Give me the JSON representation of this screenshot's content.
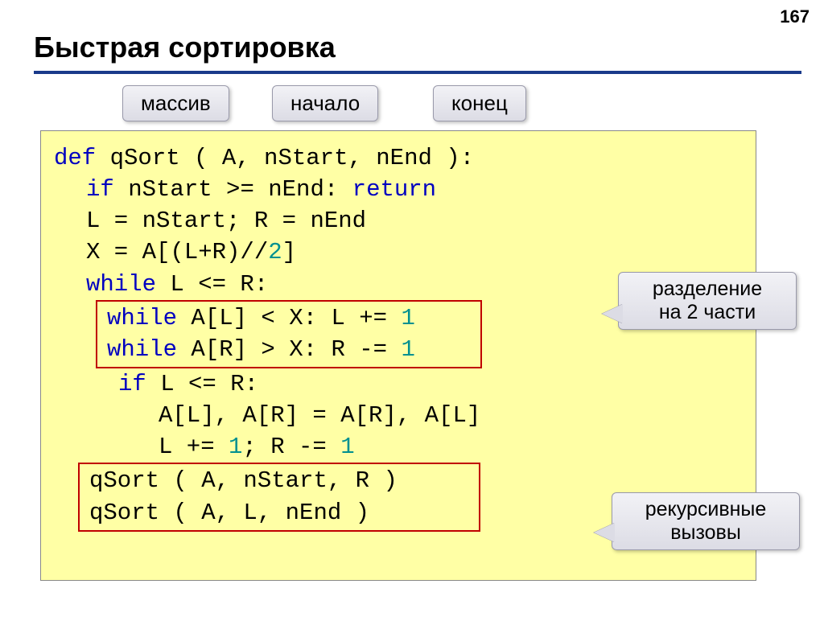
{
  "page_number": "167",
  "title": "Быстрая сортировка",
  "labels": {
    "array": "массив",
    "start": "начало",
    "end": "конец"
  },
  "callouts": {
    "split_l1": "разделение",
    "split_l2": "на 2 части",
    "rec_l1": "рекурсивные",
    "rec_l2": "вызовы"
  },
  "code": {
    "l1a": "def",
    "l1b": " qSort ( A, nStart, nEnd ):",
    "l2a": "if",
    "l2b": " nStart >= nEnd: ",
    "l2c": "return",
    "l3": "L = nStart; R = nEnd",
    "l4a": "X = A[(L+R)//",
    "l4b": "2",
    "l4c": "]",
    "l5a": "while",
    "l5b": " L <= R:",
    "l6a": "while",
    "l6b": " A[L] < X: L += ",
    "l6c": "1",
    "l7a": "while",
    "l7b": " A[R] > X: R -= ",
    "l7c": "1",
    "l8a": "if",
    "l8b": " L <= R:",
    "l9": "A[L], A[R] = A[R], A[L]",
    "l10a": "L += ",
    "l10b": "1",
    "l10c": "; R -= ",
    "l10d": "1",
    "l11": "qSort ( A, nStart, R )",
    "l12": "qSort ( A, L, nEnd )"
  }
}
